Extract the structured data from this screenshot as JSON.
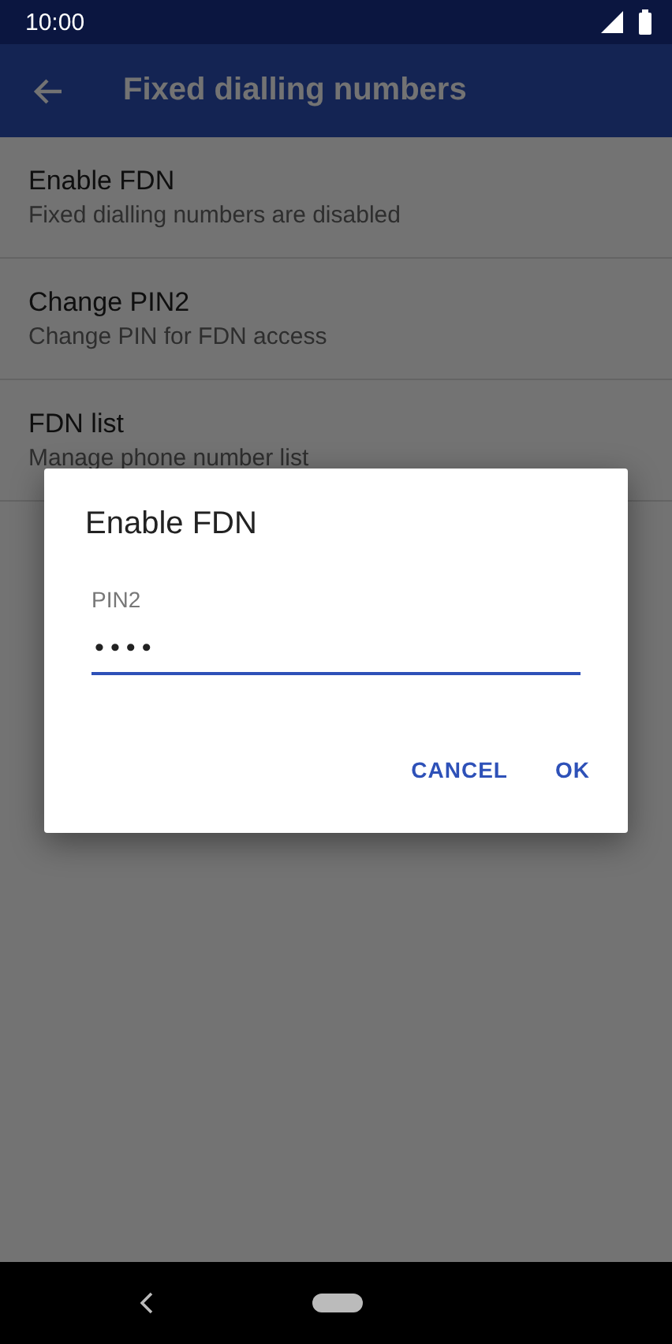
{
  "status_bar": {
    "time": "10:00"
  },
  "app_bar": {
    "title": "Fixed dialling numbers"
  },
  "settings": [
    {
      "title": "Enable FDN",
      "subtitle": "Fixed dialling numbers are disabled"
    },
    {
      "title": "Change PIN2",
      "subtitle": "Change PIN for FDN access"
    },
    {
      "title": "FDN list",
      "subtitle": "Manage phone number list"
    }
  ],
  "dialog": {
    "title": "Enable FDN",
    "field_label": "PIN2",
    "value": "••••",
    "buttons": [
      "CANCEL",
      "OK"
    ]
  }
}
